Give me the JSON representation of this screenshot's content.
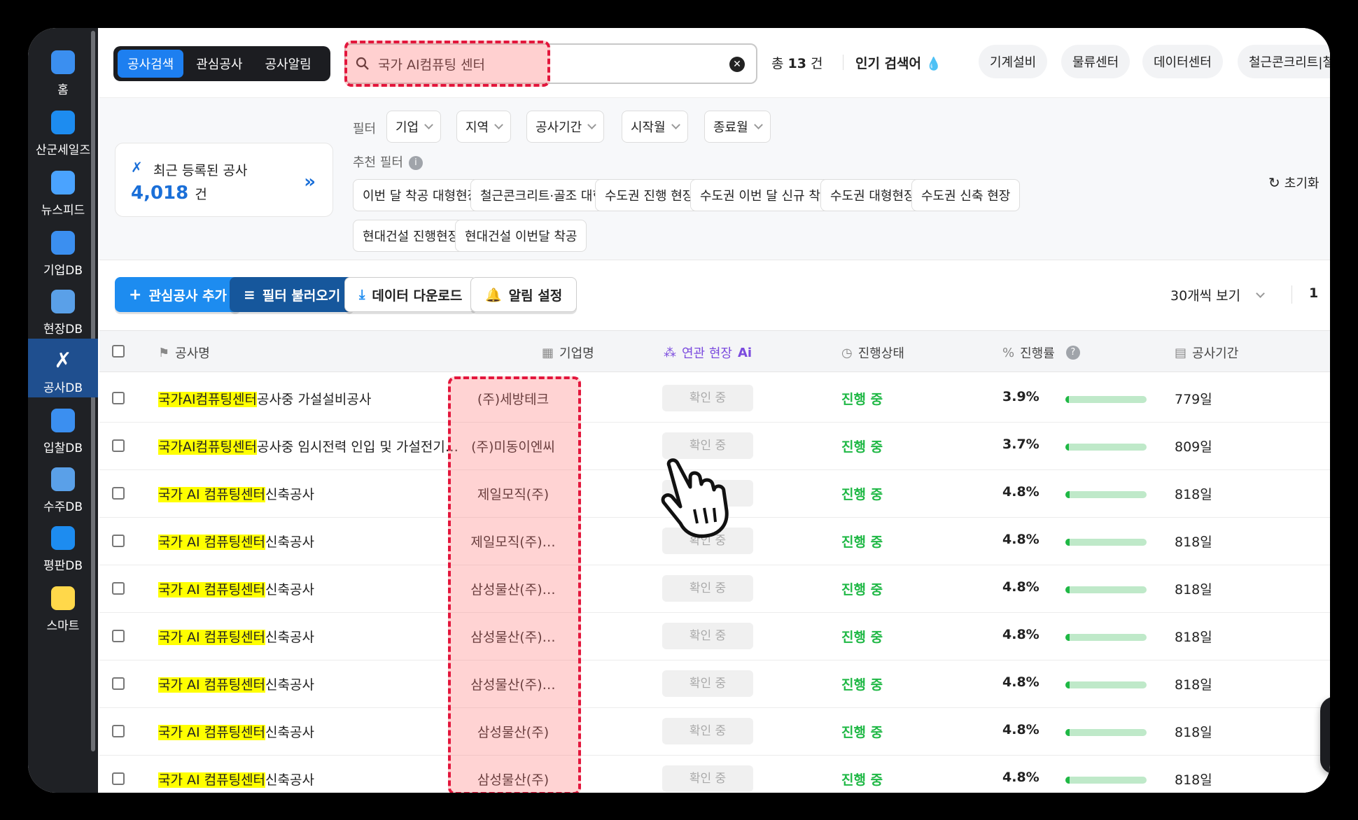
{
  "sidebar": {
    "items": [
      {
        "label": "홈",
        "icon": "home-icon"
      },
      {
        "label": "산군세일즈",
        "icon": "briefcase-icon"
      },
      {
        "label": "뉴스피드",
        "icon": "news-reader-icon"
      },
      {
        "label": "기업DB",
        "icon": "building-icon"
      },
      {
        "label": "현장DB",
        "icon": "map-pin-icon"
      },
      {
        "label": "공사DB",
        "icon": "tools-icon"
      },
      {
        "label": "입찰DB",
        "icon": "trophy-icon"
      },
      {
        "label": "수주DB",
        "icon": "document-check-icon"
      },
      {
        "label": "평판DB",
        "icon": "star-badge-icon"
      },
      {
        "label": "스마트",
        "icon": "lightbulb-icon"
      }
    ],
    "active_index": 5
  },
  "topbar": {
    "tabs": [
      "공사검색",
      "관심공사",
      "공사알림"
    ],
    "active_tab": 0,
    "search_value": "국가 AI컴퓨팅 센터",
    "total_prefix": "총",
    "total_count": "13",
    "total_suffix": "건",
    "popular_label": "인기 검색어",
    "popular_chips": [
      "기계설비",
      "물류센터",
      "데이터센터",
      "철근콘크리트|철근|"
    ]
  },
  "recent": {
    "title": "최근 등록된 공사",
    "count": "4,018",
    "unit": "건"
  },
  "filters": {
    "label": "필터",
    "dropdowns": [
      "기업",
      "지역",
      "공사기간",
      "시작월",
      "종료월"
    ],
    "recommend_label": "추천 필터",
    "recommend_chips": [
      "이번 달 착공 대형현장",
      "철근콘크리트·골조 대형",
      "수도권 진행 현장",
      "수도권 이번 달 신규 착공",
      "수도권 대형현장",
      "수도권 신축 현장",
      "현대건설 진행현장",
      "현대건설 이번달 착공"
    ],
    "reset_label": "초기화"
  },
  "actions": {
    "add_interest": "관심공사 추가",
    "load_filter": "필터 불러오기",
    "download": "데이터 다운로드",
    "alert": "알림 설정",
    "per_page": "30개씩 보기",
    "page": "1"
  },
  "table": {
    "headers": {
      "name": "공사명",
      "company": "기업명",
      "related": "연관 현장",
      "related_ai": "Ai",
      "status": "진행상태",
      "progress": "진행률",
      "period": "공사기간"
    },
    "rows": [
      {
        "hl": "국가AI컴퓨팅센터",
        "rest": "공사중 가설설비공사",
        "company": "(주)세방테크",
        "confirm": "확인 중",
        "status": "진행 중",
        "pct": "3.9%",
        "progress": 0.039,
        "dur": "779일"
      },
      {
        "hl": "국가AI컴퓨팅센터",
        "rest": "공사중 임시전력 인입 및 가설전기 …",
        "company": "(주)미동이엔씨",
        "confirm": "확인 중",
        "status": "진행 중",
        "pct": "3.7%",
        "progress": 0.037,
        "dur": "809일"
      },
      {
        "hl": "국가 AI 컴퓨팅센터",
        "rest": "신축공사",
        "company": "제일모직(주)",
        "confirm": "확인 중",
        "status": "진행 중",
        "pct": "4.8%",
        "progress": 0.048,
        "dur": "818일"
      },
      {
        "hl": "국가 AI 컴퓨팅센터",
        "rest": "신축공사",
        "company": "제일모직(주)…",
        "confirm": "확인 중",
        "status": "진행 중",
        "pct": "4.8%",
        "progress": 0.048,
        "dur": "818일"
      },
      {
        "hl": "국가 AI 컴퓨팅센터",
        "rest": "신축공사",
        "company": "삼성물산(주)…",
        "confirm": "확인 중",
        "status": "진행 중",
        "pct": "4.8%",
        "progress": 0.048,
        "dur": "818일"
      },
      {
        "hl": "국가 AI 컴퓨팅센터",
        "rest": "신축공사",
        "company": "삼성물산(주)…",
        "confirm": "확인 중",
        "status": "진행 중",
        "pct": "4.8%",
        "progress": 0.048,
        "dur": "818일"
      },
      {
        "hl": "국가 AI 컴퓨팅센터",
        "rest": "신축공사",
        "company": "삼성물산(주)…",
        "confirm": "확인 중",
        "status": "진행 중",
        "pct": "4.8%",
        "progress": 0.048,
        "dur": "818일"
      },
      {
        "hl": "국가 AI 컴퓨팅센터",
        "rest": "신축공사",
        "company": "삼성물산(주)",
        "confirm": "확인 중",
        "status": "진행 중",
        "pct": "4.8%",
        "progress": 0.048,
        "dur": "818일"
      },
      {
        "hl": "국가 AI 컴퓨팅센터",
        "rest": "신축공사",
        "company": "삼성물산(주)",
        "confirm": "확인 중",
        "status": "진행 중",
        "pct": "4.8%",
        "progress": 0.048,
        "dur": "818일"
      }
    ]
  },
  "colors": {
    "accent": "#1d8cf0",
    "status_green": "#1fb845",
    "highlight_red": "#e3163c",
    "ai_purple": "#7b4bde"
  }
}
